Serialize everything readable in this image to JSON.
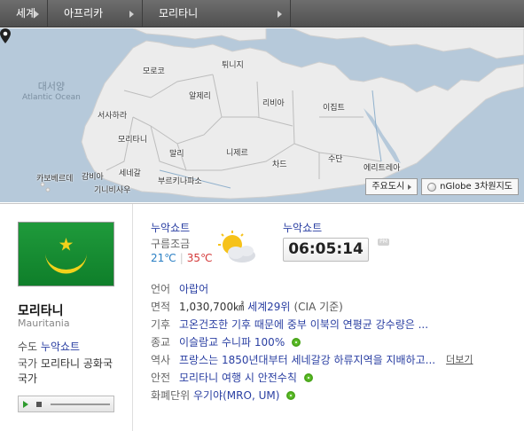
{
  "breadcrumb": {
    "items": [
      {
        "label": "세계"
      },
      {
        "label": "아프리카"
      },
      {
        "label": "모리타니"
      }
    ]
  },
  "map": {
    "ocean_label_ko": "대서양",
    "ocean_label_en": "Atlantic Ocean",
    "countries": [
      {
        "label": "튀니지"
      },
      {
        "label": "모로코"
      },
      {
        "label": "알제리"
      },
      {
        "label": "리비아"
      },
      {
        "label": "이집트"
      },
      {
        "label": "서사하라"
      },
      {
        "label": "모리타니"
      },
      {
        "label": "말리"
      },
      {
        "label": "니제르"
      },
      {
        "label": "차드"
      },
      {
        "label": "수단"
      },
      {
        "label": "에리트레아"
      },
      {
        "label": "세네갈"
      },
      {
        "label": "카보베르데"
      },
      {
        "label": "감비아"
      },
      {
        "label": "기니비사우"
      },
      {
        "label": "부르키나파소"
      }
    ],
    "buttons": {
      "major_cities": "주요도시",
      "nglobe": "nGlobe 3차원지도"
    }
  },
  "country": {
    "name_ko": "모리타니",
    "name_en": "Mauritania",
    "capital_label": "수도",
    "capital_value": "누악쇼트",
    "anthem_label": "국가",
    "anthem_value": "모리타니 공화국 국가"
  },
  "weather": {
    "city": "누악쇼트",
    "description": "구름조금",
    "temp_min": "21℃",
    "temp_max": "35℃",
    "icon": "partly-cloudy-icon"
  },
  "clock": {
    "city": "누악쇼트",
    "time": "06:05:14",
    "ampm": "PM"
  },
  "facts": {
    "language_label": "언어",
    "language_value": "아랍어",
    "area_label": "면적",
    "area_value": "1,030,700㎢",
    "area_rank": "세계29위",
    "area_source": "(CIA 기준)",
    "climate_label": "기후",
    "climate_value": "고온건조한 기후 때문에 중부 이북의 연평균 강수량은 ...",
    "religion_label": "종교",
    "religion_value": "이슬람교 수니파 100%",
    "history_label": "역사",
    "history_value": "프랑스는 1850년대부터 세네갈강 하류지역을 지배하고...",
    "history_more": "더보기",
    "safety_label": "안전",
    "safety_value": "모리타니 여행 시 안전수칙",
    "currency_label": "화폐단위",
    "currency_value": "우기야(MRO, UM)"
  },
  "colors": {
    "link_blue": "#2a3fa2",
    "temp_min": "#2a7fc4",
    "temp_max": "#d43a3a",
    "flag_green": "#1f9a3b",
    "flag_gold": "#f2d21b",
    "map_land": "#ececec",
    "map_sea": "#b6c9da"
  }
}
